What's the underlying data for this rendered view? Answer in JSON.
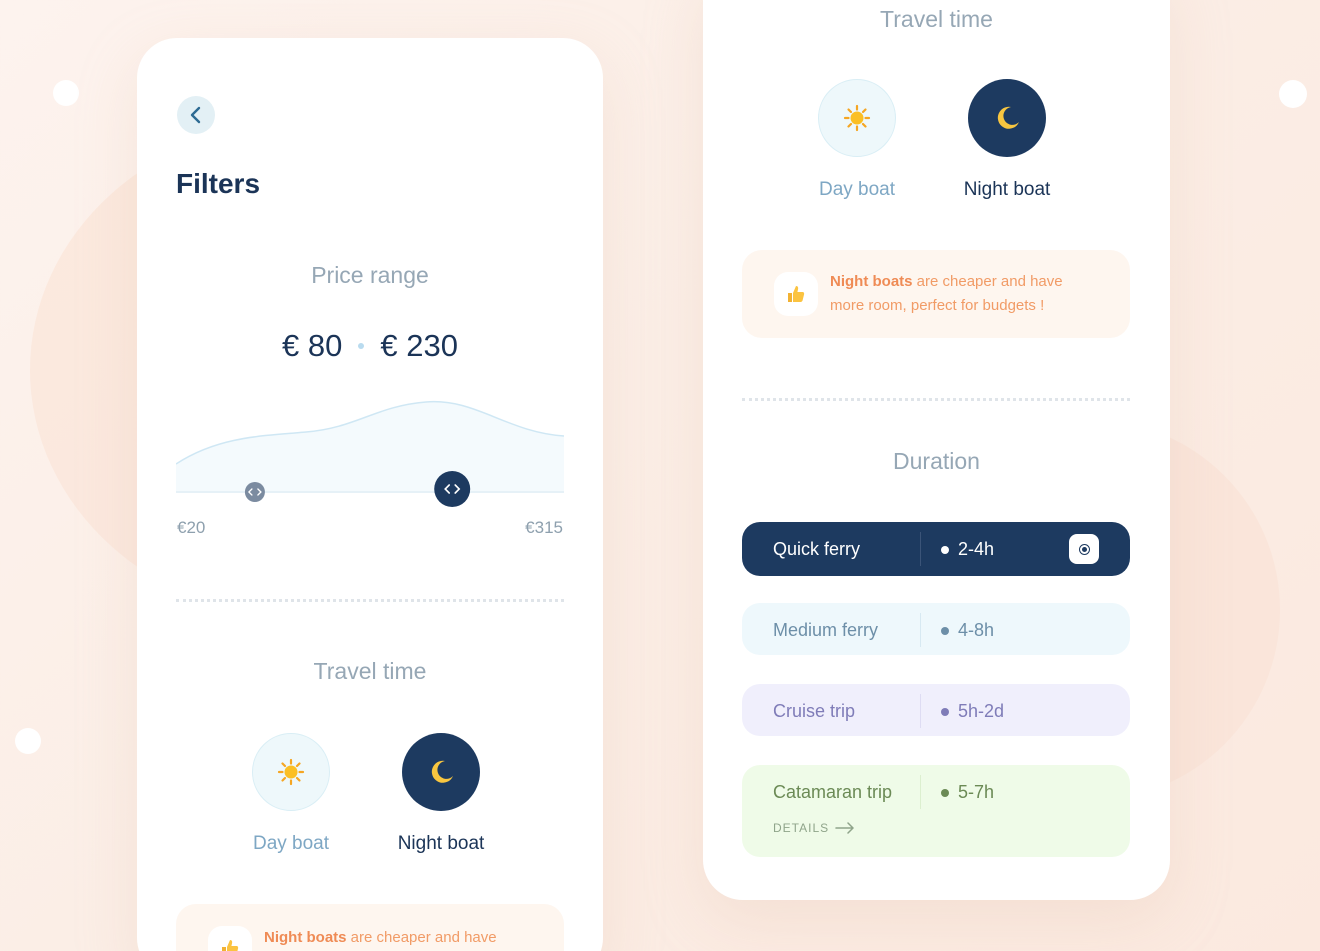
{
  "filters_card": {
    "title": "Filters",
    "price_range": {
      "title": "Price range",
      "selected_min": "€ 80",
      "selected_max": "€ 230",
      "range_min_label": "€20",
      "range_max_label": "€315",
      "range_min": 20,
      "range_max": 315,
      "handle_min_value": 80,
      "handle_max_value": 230
    },
    "travel_time": {
      "title": "Travel time",
      "options": [
        {
          "label": "Day boat",
          "icon": "sun-icon",
          "selected": false
        },
        {
          "label": "Night boat",
          "icon": "moon-icon",
          "selected": true
        }
      ]
    },
    "tip": {
      "highlight": "Night boats",
      "text": " are cheaper and have"
    }
  },
  "details_card": {
    "travel_time": {
      "title": "Travel time",
      "options": [
        {
          "label": "Day boat",
          "icon": "sun-icon",
          "selected": false
        },
        {
          "label": "Night boat",
          "icon": "moon-icon",
          "selected": true
        }
      ]
    },
    "tip": {
      "highlight": "Night boats",
      "text_line1": " are cheaper and have",
      "text_line2": "more room, perfect for budgets !",
      "icon": "thumbs-up-icon"
    },
    "duration": {
      "title": "Duration",
      "options": [
        {
          "name": "Quick ferry",
          "time": "2-4h",
          "selected": true
        },
        {
          "name": "Medium ferry",
          "time": "4-8h",
          "selected": false
        },
        {
          "name": "Cruise trip",
          "time": "5h-2d",
          "selected": false
        },
        {
          "name": "Catamaran trip",
          "time": "5-7h",
          "selected": false,
          "details_label": "DETAILS"
        }
      ]
    }
  },
  "colors": {
    "navy": "#1d3a60",
    "tip_orange": "#f19b66",
    "medium_bg": "#eef8fc",
    "cruise_bg": "#f0effc",
    "catamaran_bg": "#effbe8"
  }
}
